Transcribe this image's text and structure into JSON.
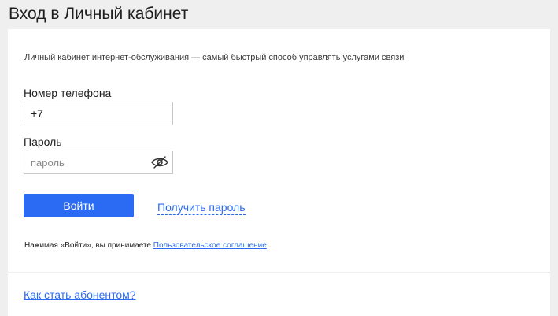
{
  "header": {
    "title": "Вход в Личный кабинет"
  },
  "form": {
    "subtitle": "Личный кабинет интернет-обслуживания — самый быстрый способ управлять услугами связи",
    "phone": {
      "label": "Номер телефона",
      "value": "+7"
    },
    "password": {
      "label": "Пароль",
      "placeholder": "пароль",
      "toggle_icon": "eye-slash-icon"
    },
    "login_button": "Войти",
    "get_password_link": "Получить пароль",
    "agreement": {
      "prefix": "Нажимая «Войти», вы принимаете ",
      "link": "Пользовательское соглашение",
      "suffix": " ."
    }
  },
  "footer": {
    "become_subscriber_link": "Как стать абонентом?"
  },
  "colors": {
    "accent": "#2b6bf3",
    "background": "#efefef",
    "card": "#ffffff"
  }
}
